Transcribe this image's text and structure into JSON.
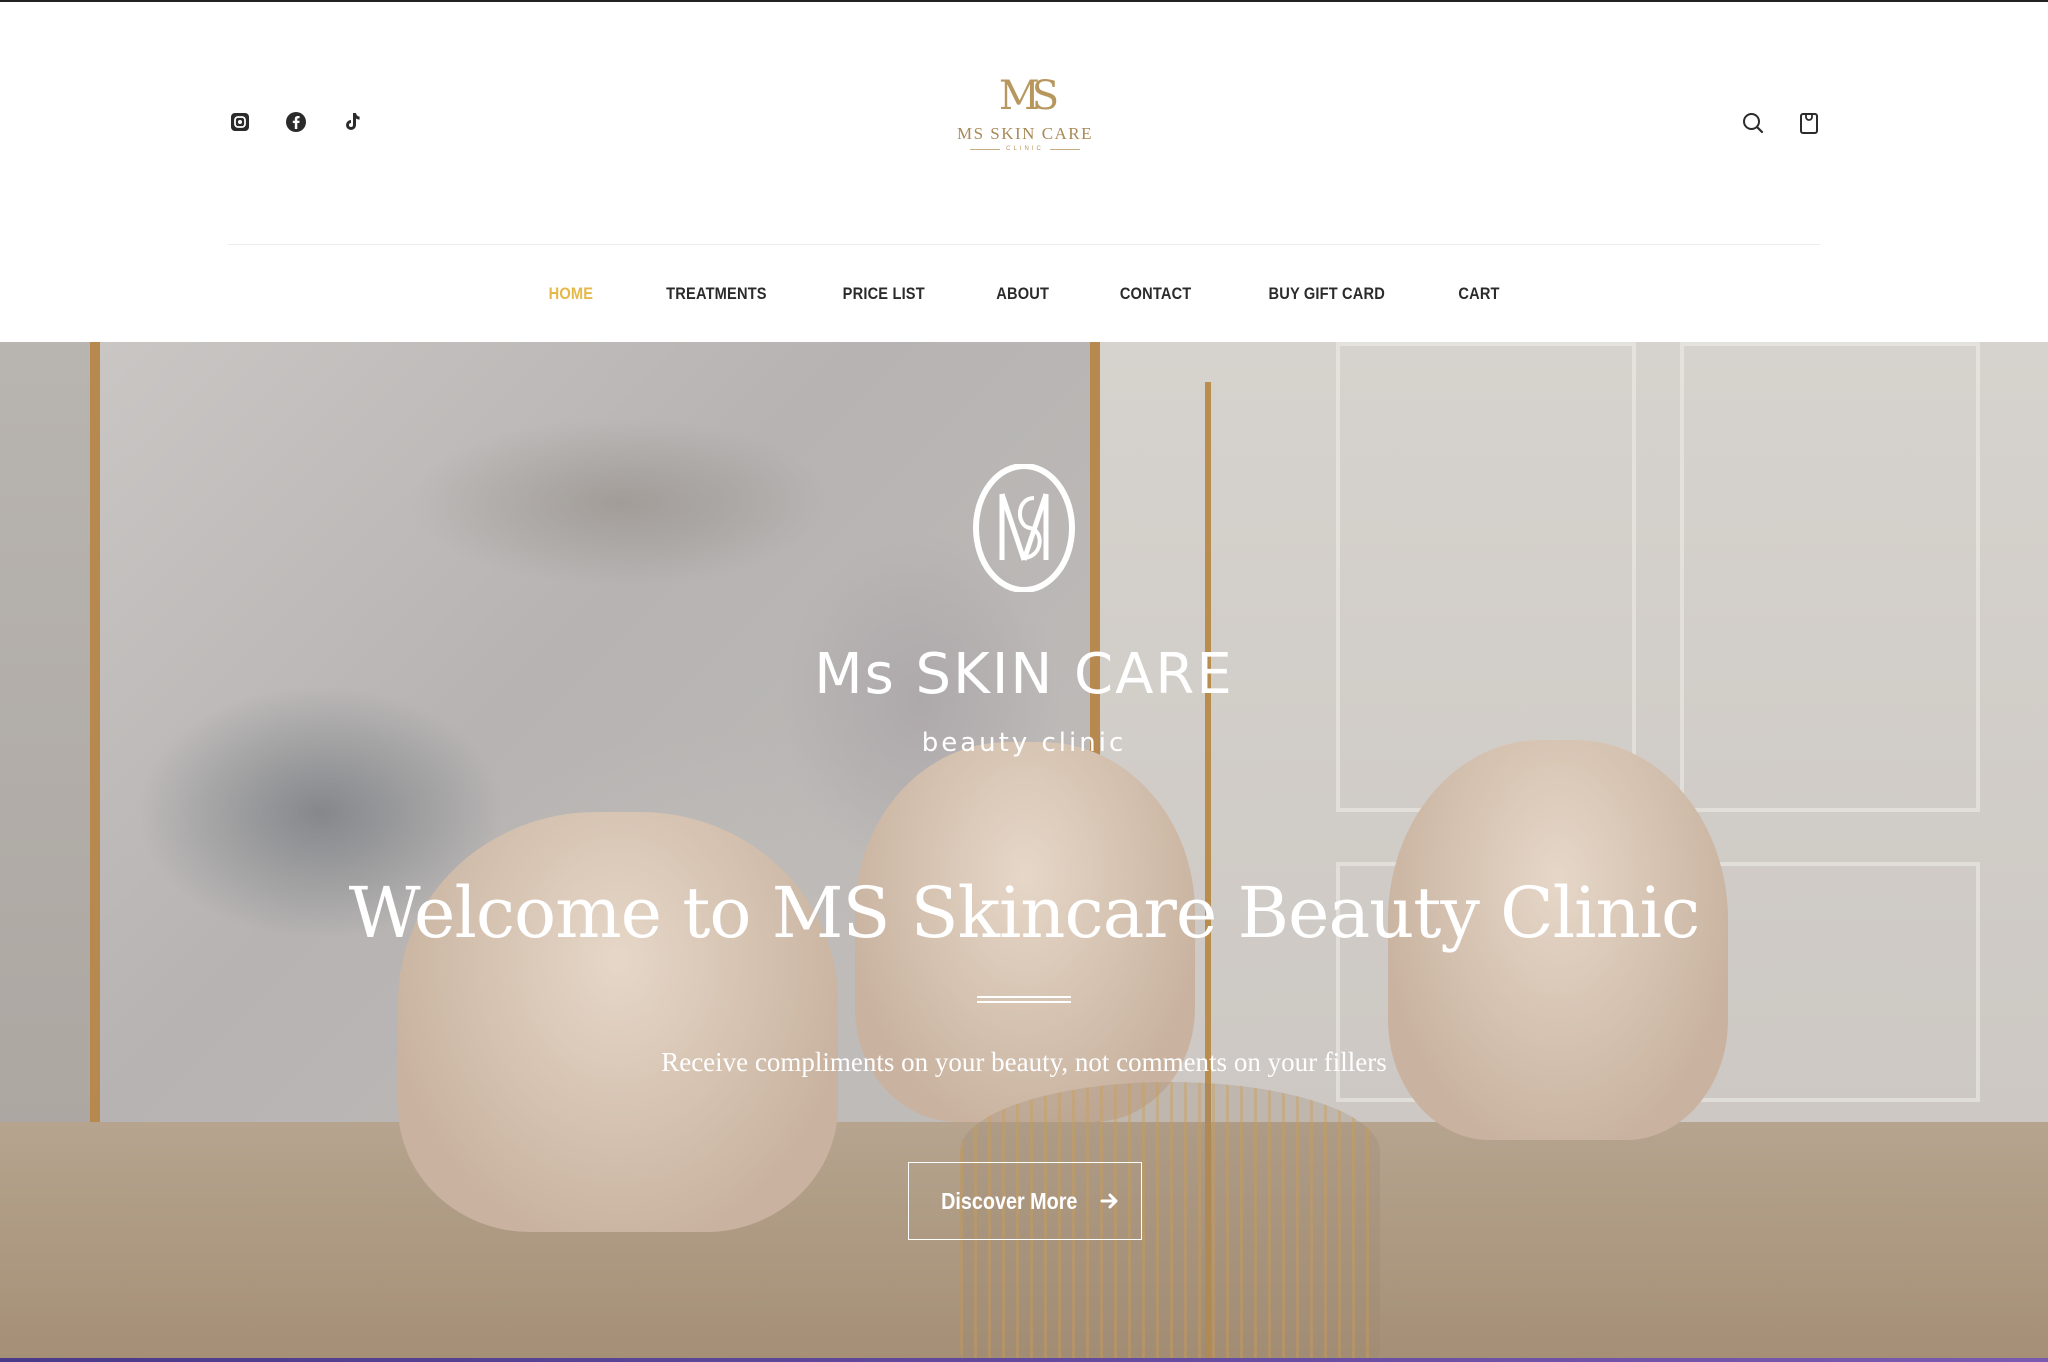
{
  "social": {
    "instagram_icon": "instagram-icon",
    "facebook_icon": "facebook-icon",
    "tiktok_icon": "tiktok-icon"
  },
  "logo": {
    "monogram": "MS",
    "name": "MS SKIN CARE",
    "subtitle": "CLINIC"
  },
  "nav": {
    "items": [
      {
        "label": "HOME",
        "active": true
      },
      {
        "label": "TREATMENTS"
      },
      {
        "label": "PRICE LIST"
      },
      {
        "label": "ABOUT"
      },
      {
        "label": "CONTACT"
      },
      {
        "label": "BUY GIFT CARD"
      },
      {
        "label": "CART"
      }
    ]
  },
  "hero": {
    "brand_name": "Ms SKIN CARE",
    "brand_sub": "beauty clinic",
    "headline": "Welcome to MS Skincare Beauty Clinic",
    "tagline": "Receive compliments on your beauty, not comments on your fillers",
    "cta_label": "Discover More"
  },
  "colors": {
    "accent_gold": "#e6b84a",
    "logo_gold": "#b8975e",
    "nav_text": "#2b2b2b"
  }
}
